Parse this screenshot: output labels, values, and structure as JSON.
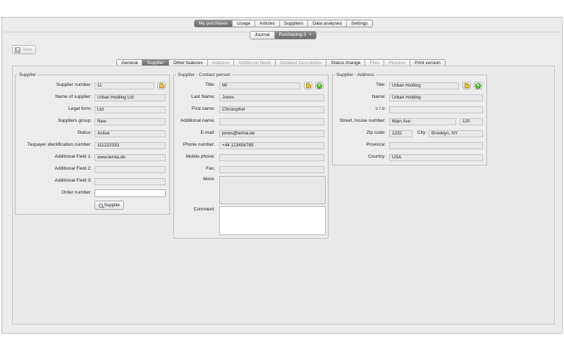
{
  "main_tabs": [
    "My purchases",
    "Usage",
    "Articles",
    "Suppliers",
    "Data analyses",
    "Settings"
  ],
  "sub_tabs": {
    "journal": "Journal",
    "purchasing": "Purchasing 3",
    "close": "×"
  },
  "toolbar": {
    "save_label": "Save"
  },
  "detail_tabs": [
    "General",
    "Supplier",
    "Other features",
    "Address",
    "Additional fields",
    "Detailed Description",
    "Status change",
    "Files",
    "Pictures",
    "Print version"
  ],
  "supplier": {
    "legend": "Supplier",
    "fields": [
      {
        "label": "Supplier number:",
        "value": "11"
      },
      {
        "label": "Name of supplier:",
        "value": "Urban Holding Ltd"
      },
      {
        "label": "Legal form:",
        "value": "Ltd"
      },
      {
        "label": "Suppliers group:",
        "value": "New"
      },
      {
        "label": "Status:",
        "value": "Active"
      },
      {
        "label": "Taxpayer identification number:",
        "value": "111222333"
      },
      {
        "label": "Additional Field 1:",
        "value": "www.temia.de"
      },
      {
        "label": "Additional Field 2:",
        "value": ""
      },
      {
        "label": "Additional Field 3:",
        "value": ""
      },
      {
        "label": "Order number:",
        "value": ""
      }
    ],
    "button_label": "Supplier"
  },
  "contact": {
    "legend": "Supplier - Contact person",
    "fields": [
      {
        "label": "Title:",
        "value": "Mr"
      },
      {
        "label": "Last Name:",
        "value": "Jones"
      },
      {
        "label": "First name:",
        "value": "Christopher"
      },
      {
        "label": "Additional name:",
        "value": ""
      },
      {
        "label": "E-mail:",
        "value": "jones@temia.de"
      },
      {
        "label": "Phone number:",
        "value": "+44 123456789"
      },
      {
        "label": "Mobile phone:",
        "value": ""
      },
      {
        "label": "Fax:",
        "value": ""
      }
    ],
    "more_label": "More:",
    "comment_label": "Comment:"
  },
  "address": {
    "legend": "Supplier - Address",
    "title_label": "Title:",
    "title_value": "Urban Holding",
    "name_label": "Name:",
    "name_value": "Urban Holding",
    "co_label": "c / o:",
    "co_value": "",
    "street_label": "Street, house number:",
    "street_value": "Main Ave",
    "house_value": "120",
    "zip_label": "Zip code:",
    "zip_value": "1232",
    "city_label": "City:",
    "city_value": "Brooklyn, NY",
    "province_label": "Province:",
    "province_value": "",
    "country_label": "Country:",
    "country_value": "USA"
  }
}
